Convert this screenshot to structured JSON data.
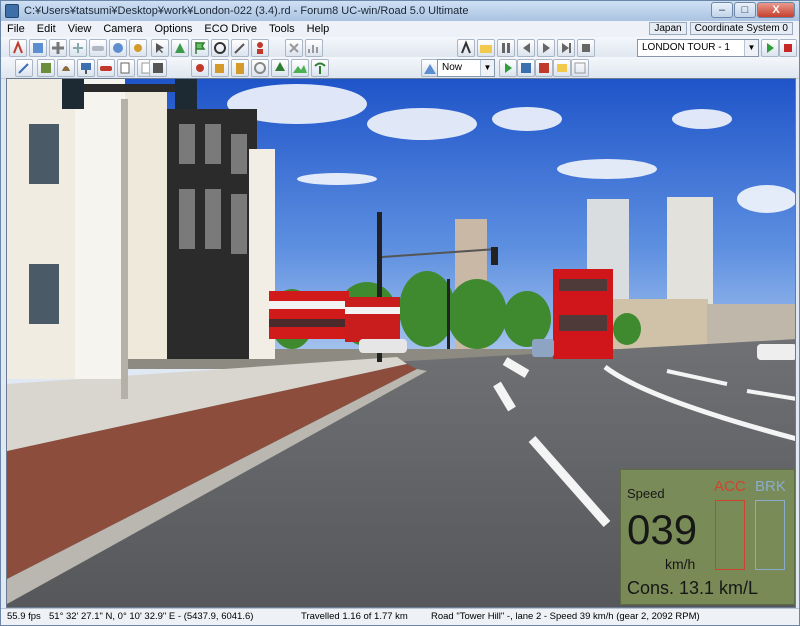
{
  "window": {
    "title": "C:¥Users¥tatsumi¥Desktop¥work¥London-022 (3.4).rd - Forum8 UC-win/Road 5.0 Ultimate",
    "minimize": "–",
    "maximize": "□",
    "close": "X"
  },
  "menu": [
    "File",
    "Edit",
    "View",
    "Camera",
    "Options",
    "ECO Drive",
    "Tools",
    "Help"
  ],
  "top_right": {
    "region": "Japan",
    "coord_system": "Coordinate System 0"
  },
  "toolbar": {
    "time_select": "Now",
    "scenario_select": "LONDON TOUR - 1"
  },
  "hud": {
    "speed_label": "Speed",
    "speed_value": "039",
    "speed_unit": "km/h",
    "acc_label": "ACC",
    "brk_label": "BRK",
    "consumption": "Cons. 13.1 km/L",
    "colors": {
      "acc": "#d8422a",
      "brk": "#8fb3d6",
      "panel": "#7c8f57"
    }
  },
  "status": {
    "fps": "55.9 fps",
    "coords": "51° 32' 27.1\" N, 0° 10' 32.9\" E  -  (5437.9, 6041.6)",
    "travelled": "Travelled 1.16 of 1.77 km",
    "road": "Road \"Tower Hill\" -, lane 2 - Speed 39 km/h (gear 2, 2092 RPM)"
  }
}
